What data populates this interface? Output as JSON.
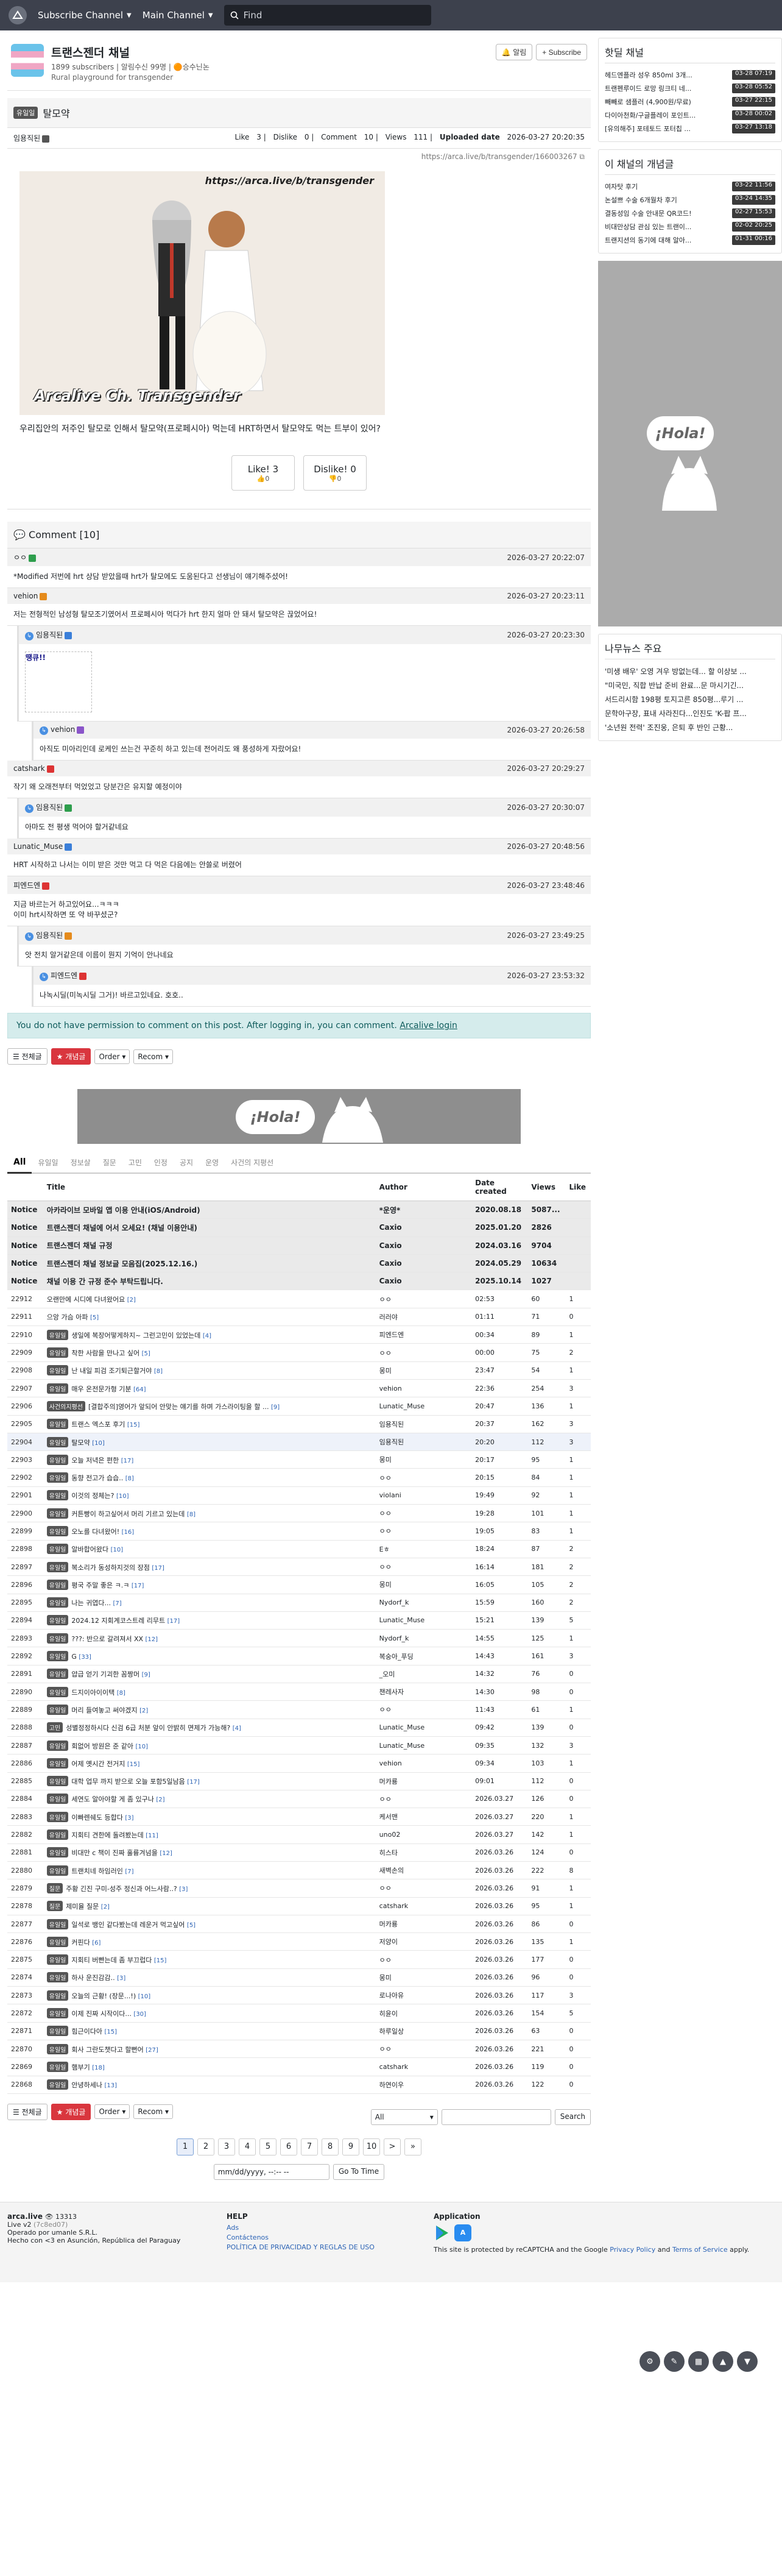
{
  "topbar": {
    "subscribe": "Subscribe Channel",
    "main": "Main Channel",
    "search_placeholder": "Find"
  },
  "channel": {
    "title": "트랜스젠더 채널",
    "meta": "1899 subscribers | 알림수신 99명 | 🟠승수닌논",
    "desc": "Rural playground for transgender",
    "alarm": "알림",
    "subscribe": "+ Subscribe"
  },
  "article": {
    "category": "유일일",
    "title": "탈모약",
    "author": "임용직된",
    "stats": {
      "like_label": "Like",
      "like": "3",
      "dislike_label": "Dislike",
      "dislike": "0",
      "comment_label": "Comment",
      "comment": "10",
      "views_label": "Views",
      "views": "111",
      "uploaded_label": "Uploaded date",
      "uploaded": "2026-03-27 20:20:35"
    },
    "url": "https://arca.live/b/transgender/166003267",
    "img_watermark": "https://arca.live/b/transgender",
    "img_caption": "Arcalive Ch. Transgender",
    "body": "우리집안의 저주인 탈모로 인해서 탈모약(프로페시아) 먹는데 HRT하면서 탈모약도 먹는 트부이 있어?",
    "vote": {
      "like": "Like!",
      "like_n": "3",
      "like_sub": "0",
      "dislike": "Dislike!",
      "dislike_n": "0",
      "dislike_sub": "0"
    }
  },
  "comments": {
    "header": "Comment [10]",
    "items": [
      {
        "author": "ㅇㅇ",
        "date": "2026-03-27 20:22:07",
        "text": "*Modified 저번에 hrt 상담 받았을때 hrt가 탈모에도 도움된다고 선생님이 얘기해주셨어!",
        "depth": 0
      },
      {
        "author": "vehion",
        "date": "2026-03-27 20:23:11",
        "text": "저는 전형적인 남성형 탈모조기였어서 프로페시아 먹다가 hrt 한지 얼마 안 돼서 탈모약은 끊었어요!",
        "depth": 0
      },
      {
        "author": "임용직된",
        "date": "2026-03-27 20:23:30",
        "text": "",
        "sticker": "땡큐!!",
        "depth": 1
      },
      {
        "author": "vehion",
        "date": "2026-03-27 20:26:58",
        "text": "아직도 미아리인데 로케인 쓰는건 꾸준히 하고 있는데 전어리도 왜 풍성하게 자랐어요!",
        "depth": 2
      },
      {
        "author": "catshark",
        "date": "2026-03-27 20:29:27",
        "text": "작기 왜 오래전부터 먹었었고 당분간은 유지할 예정이야",
        "depth": 0
      },
      {
        "author": "임용직된",
        "date": "2026-03-27 20:30:07",
        "text": "아마도 전 평생 먹어야 할거같네요",
        "depth": 1
      },
      {
        "author": "Lunatic_Muse",
        "date": "2026-03-27 20:48:56",
        "text": "HRT 시작하고 나서는 이미 받은 것만 먹고 다 먹은 다음에는 안쓸로 버렸어",
        "depth": 0
      },
      {
        "author": "피엔드엔",
        "date": "2026-03-27 23:48:46",
        "text": "지금 바르는거 하고있어요...ㅋㅋㅋ\n이미 hrt시작하면 또 약 바꾸셨군?",
        "depth": 0
      },
      {
        "author": "임용직된",
        "date": "2026-03-27 23:49:25",
        "text": "앗 전치 알거같은데 이름이 뭔지 기억이 안나네요",
        "depth": 1
      },
      {
        "author": "피엔드엔",
        "date": "2026-03-27 23:53:32",
        "text": "나녹시딜(미녹시딜 그거)! 바르고있네요. 호호..",
        "depth": 2
      }
    ],
    "no_permission": "You do not have permission to comment on this post. After logging in, you can comment.",
    "login": "Arcalive login"
  },
  "board": {
    "btn_all": "전체글",
    "btn_best": "개념글",
    "order": "Order",
    "recom": "Recom",
    "tabs": [
      "All",
      "유일일",
      "정보살",
      "질문",
      "고민",
      "인정",
      "공지",
      "운영",
      "사건의 지평선"
    ],
    "headers": {
      "no": "",
      "title": "Title",
      "author": "Author",
      "date": "Date created",
      "views": "Views",
      "like": "Like"
    },
    "notices": [
      {
        "no": "Notice",
        "title": "아카라이브 모바일 앱 이용 안내(iOS/Android)",
        "author": "*운영*",
        "date": "2020.08.18",
        "views": "5087...",
        "like": ""
      },
      {
        "no": "Notice",
        "title": "트랜스젠더 채널에 어서 오세요! (채널 이용안내)",
        "author": "Caxio",
        "date": "2025.01.20",
        "views": "2826",
        "like": ""
      },
      {
        "no": "Notice",
        "title": "트랜스젠더 채널 규정",
        "author": "Caxio",
        "date": "2024.03.16",
        "views": "9704",
        "like": ""
      },
      {
        "no": "Notice",
        "title": "트랜스젠더 채널 정보글 모음집(2025.12.16.)",
        "author": "Caxio",
        "date": "2024.05.29",
        "views": "10634",
        "like": ""
      },
      {
        "no": "Notice",
        "title": "채널 이용 간 규정 준수 부탁드립니다.",
        "author": "Caxio",
        "date": "2025.10.14",
        "views": "1027",
        "like": ""
      }
    ],
    "rows": [
      {
        "no": "22912",
        "cat": "",
        "title": "오랜만에 시디에 다녀왔어요",
        "cc": "[2]",
        "author": "ㅇㅇ",
        "date": "02:53",
        "views": "60",
        "like": "1"
      },
      {
        "no": "22911",
        "cat": "",
        "title": "으앙 가슴 아파",
        "cc": "[5]",
        "author": "러러야",
        "date": "01:11",
        "views": "71",
        "like": "0"
      },
      {
        "no": "22910",
        "cat": "유일일",
        "title": "생일에 복장어떻게하지~ 그런고민이 있었는데",
        "cc": "[4]",
        "author": "피엔드엔",
        "date": "00:34",
        "views": "89",
        "like": "1"
      },
      {
        "no": "22909",
        "cat": "유일일",
        "title": "착한 사람을 만나고 싶어",
        "cc": "[5]",
        "author": "ㅇㅇ",
        "date": "00:00",
        "views": "75",
        "like": "2"
      },
      {
        "no": "22908",
        "cat": "유일일",
        "title": "난 내일 피검 조기퇴근할거야",
        "cc": "[8]",
        "author": "몽미",
        "date": "23:47",
        "views": "54",
        "like": "1"
      },
      {
        "no": "22907",
        "cat": "유일일",
        "title": "매우 온전문가형 기분",
        "cc": "[64]",
        "author": "vehion",
        "date": "22:36",
        "views": "254",
        "like": "3"
      },
      {
        "no": "22906",
        "cat": "사건의지평선",
        "title": "[결합주의]영어가 앞되어 안맞는 얘기를 하며 가스라이팅을 할 ...",
        "cc": "[9]",
        "author": "Lunatic_Muse",
        "date": "20:47",
        "views": "136",
        "like": "1"
      },
      {
        "no": "22905",
        "cat": "유일일",
        "title": "트랜스 엑스포 후기",
        "cc": "[15]",
        "author": "임용직된",
        "date": "20:37",
        "views": "162",
        "like": "3"
      },
      {
        "no": "22904",
        "cat": "유일일",
        "title": "탈모약",
        "cc": "[10]",
        "author": "임용직된",
        "date": "20:20",
        "views": "112",
        "like": "3"
      },
      {
        "no": "22903",
        "cat": "유일일",
        "title": "오늘 저녁은 편한",
        "cc": "[17]",
        "author": "몽미",
        "date": "20:17",
        "views": "95",
        "like": "1"
      },
      {
        "no": "22902",
        "cat": "유일일",
        "title": "동향 전고가 습습..",
        "cc": "[8]",
        "author": "ㅇㅇ",
        "date": "20:15",
        "views": "84",
        "like": "1"
      },
      {
        "no": "22901",
        "cat": "유일일",
        "title": "이것의 정체는?",
        "cc": "[10]",
        "author": "violani",
        "date": "19:49",
        "views": "92",
        "like": "1"
      },
      {
        "no": "22900",
        "cat": "유일일",
        "title": "커튼빵이 하고싶어서 머리 기르고 있는데",
        "cc": "[8]",
        "author": "ㅇㅇ",
        "date": "19:28",
        "views": "101",
        "like": "1"
      },
      {
        "no": "22899",
        "cat": "유일일",
        "title": "오노를 다녀왔어!",
        "cc": "[16]",
        "author": "ㅇㅇ",
        "date": "19:05",
        "views": "83",
        "like": "1"
      },
      {
        "no": "22898",
        "cat": "유일일",
        "title": "알바합어왔다",
        "cc": "[10]",
        "author": "Eㅎ",
        "date": "18:24",
        "views": "87",
        "like": "2"
      },
      {
        "no": "22897",
        "cat": "유일일",
        "title": "복소리가 동성하지것의 장점",
        "cc": "[17]",
        "author": "ㅇㅇ",
        "date": "16:14",
        "views": "181",
        "like": "2"
      },
      {
        "no": "22896",
        "cat": "유일일",
        "title": "평국 주말 좋은 ㅋ.ㅋ",
        "cc": "[17]",
        "author": "몽미",
        "date": "16:05",
        "views": "105",
        "like": "2"
      },
      {
        "no": "22895",
        "cat": "유일일",
        "title": "나는 귀엽다...",
        "cc": "[7]",
        "author": "Nydorf_k",
        "date": "15:59",
        "views": "160",
        "like": "2"
      },
      {
        "no": "22894",
        "cat": "유일일",
        "title": "2024.12 지회계코스트레 리무트",
        "cc": "[17]",
        "author": "Lunatic_Muse",
        "date": "15:21",
        "views": "139",
        "like": "5"
      },
      {
        "no": "22893",
        "cat": "유일일",
        "title": "???: 반으로 갈려져서 XX",
        "cc": "[12]",
        "author": "Nydorf_k",
        "date": "14:55",
        "views": "125",
        "like": "1"
      },
      {
        "no": "22892",
        "cat": "유일일",
        "title": "G",
        "cc": "[33]",
        "author": "복숭아_푸딩",
        "date": "14:43",
        "views": "161",
        "like": "3"
      },
      {
        "no": "22891",
        "cat": "유일일",
        "title": "얍급 얻기 기괴한 꼼짱머",
        "cc": "[9]",
        "author": "_오미",
        "date": "14:32",
        "views": "76",
        "like": "0"
      },
      {
        "no": "22890",
        "cat": "유일일",
        "title": "드지이아이이택",
        "cc": "[8]",
        "author": "챈레사자",
        "date": "14:30",
        "views": "98",
        "like": "0"
      },
      {
        "no": "22889",
        "cat": "유일일",
        "title": "머리 들여놓고 써야겠지",
        "cc": "[2]",
        "author": "ㅇㅇ",
        "date": "11:43",
        "views": "61",
        "like": "1"
      },
      {
        "no": "22888",
        "cat": "고민",
        "title": "성별정정하시다 신검 6급 처분 앞이 안밝히 면제가 가능해?",
        "cc": "[4]",
        "author": "Lunatic_Muse",
        "date": "09:42",
        "views": "139",
        "like": "0"
      },
      {
        "no": "22887",
        "cat": "유일일",
        "title": "회없어 방원은 준 같아",
        "cc": "[10]",
        "author": "Lunatic_Muse",
        "date": "09:35",
        "views": "132",
        "like": "3"
      },
      {
        "no": "22886",
        "cat": "유일일",
        "title": "어제 옛시간 전거지",
        "cc": "[15]",
        "author": "vehion",
        "date": "09:34",
        "views": "103",
        "like": "1"
      },
      {
        "no": "22885",
        "cat": "유일일",
        "title": "대학 업무 까지 받으로 오늘 포함5일남음",
        "cc": "[17]",
        "author": "머카룡",
        "date": "09:01",
        "views": "112",
        "like": "0"
      },
      {
        "no": "22884",
        "cat": "유일일",
        "title": "세연도 알아야할 게 좀 있구나",
        "cc": "[2]",
        "author": "ㅇㅇ",
        "date": "2026.03.27",
        "views": "126",
        "like": "0"
      },
      {
        "no": "22883",
        "cat": "유일일",
        "title": "이빠렌쉐도 등합다",
        "cc": "[3]",
        "author": "케서맨",
        "date": "2026.03.27",
        "views": "220",
        "like": "1"
      },
      {
        "no": "22882",
        "cat": "유일일",
        "title": "지회티 견한에 돌려봤는데",
        "cc": "[11]",
        "author": "uno02",
        "date": "2026.03.27",
        "views": "142",
        "like": "1"
      },
      {
        "no": "22881",
        "cat": "유일일",
        "title": "비대만 c 책이 진짜 훌륭겨넘을",
        "cc": "[12]",
        "author": "히스타",
        "date": "2026.03.26",
        "views": "124",
        "like": "0"
      },
      {
        "no": "22880",
        "cat": "유일일",
        "title": "트랜치네 하임러인",
        "cc": "[7]",
        "author": "새벽손의",
        "date": "2026.03.26",
        "views": "222",
        "like": "8"
      },
      {
        "no": "22879",
        "cat": "질문",
        "title": "주황 긴진 구미-성주 정신과 어느사람..?",
        "cc": "[3]",
        "author": "ㅇㅇ",
        "date": "2026.03.26",
        "views": "91",
        "like": "1"
      },
      {
        "no": "22878",
        "cat": "질문",
        "title": "제미율 질문",
        "cc": "[2]",
        "author": "catshark",
        "date": "2026.03.26",
        "views": "95",
        "like": "1"
      },
      {
        "no": "22877",
        "cat": "유일일",
        "title": "일석로 뱅인 같다봤는데 레운거 먹고싶어",
        "cc": "[5]",
        "author": "머카룡",
        "date": "2026.03.26",
        "views": "86",
        "like": "0"
      },
      {
        "no": "22876",
        "cat": "유일일",
        "title": "커핀다",
        "cc": "[6]",
        "author": "저양이",
        "date": "2026.03.26",
        "views": "135",
        "like": "1"
      },
      {
        "no": "22875",
        "cat": "유일일",
        "title": "지회티 버빤는데 좀 부끄럽다",
        "cc": "[15]",
        "author": "ㅇㅇ",
        "date": "2026.03.26",
        "views": "177",
        "like": "0"
      },
      {
        "no": "22874",
        "cat": "유일일",
        "title": "하사 운진감감..",
        "cc": "[3]",
        "author": "몽미",
        "date": "2026.03.26",
        "views": "96",
        "like": "0"
      },
      {
        "no": "22873",
        "cat": "유일일",
        "title": "오늘의 근황! (장문...!)",
        "cc": "[10]",
        "author": "로나아유",
        "date": "2026.03.26",
        "views": "117",
        "like": "3"
      },
      {
        "no": "22872",
        "cat": "유일일",
        "title": "이제 진짜 시작이다...",
        "cc": "[30]",
        "author": "히윤이",
        "date": "2026.03.26",
        "views": "154",
        "like": "5"
      },
      {
        "no": "22871",
        "cat": "유일일",
        "title": "힘근이다아",
        "cc": "[15]",
        "author": "하루일상",
        "date": "2026.03.26",
        "views": "63",
        "like": "0"
      },
      {
        "no": "22870",
        "cat": "유일일",
        "title": "회사 그란도챗다고 할뻔어",
        "cc": "[27]",
        "author": "ㅇㅇ",
        "date": "2026.03.26",
        "views": "221",
        "like": "0"
      },
      {
        "no": "22869",
        "cat": "유일일",
        "title": "햄부기",
        "cc": "[18]",
        "author": "catshark",
        "date": "2026.03.26",
        "views": "119",
        "like": "0"
      },
      {
        "no": "22868",
        "cat": "유일일",
        "title": "안녕하세나",
        "cc": "[13]",
        "author": "하연이우",
        "date": "2026.03.26",
        "views": "122",
        "like": "0"
      }
    ],
    "search": {
      "scope": "All",
      "button": "Search"
    },
    "pages": [
      "1",
      "2",
      "3",
      "4",
      "5",
      "6",
      "7",
      "8",
      "9",
      "10",
      ">",
      "»"
    ],
    "date_placeholder": "mm/dd/yyyy,  --:-- --",
    "goto": "Go To Time"
  },
  "sidebar": {
    "hot_title": "핫딜 채널",
    "hot": [
      {
        "t": "헤드엔플라 성우 850ml 3개...",
        "tm": "03-28 07:19"
      },
      {
        "t": "트랜펜루이드 로망 링크티 네...",
        "tm": "03-28 05:52"
      },
      {
        "t": "빼빼로 샘플러 (4,900원/무료)",
        "tm": "03-27 22:15"
      },
      {
        "t": "다이아천화/구글플레이 포인트...",
        "tm": "03-28 00:02"
      },
      {
        "t": "[유의해주] 포테토드 포터칩 ...",
        "tm": "03-27 13:18"
      }
    ],
    "best_title": "이 채널의 개념글",
    "best": [
      {
        "t": "여자탓 후기",
        "tm": "03-22 11:56"
      },
      {
        "t": "논설쁘 수술 6개월차 후기",
        "tm": "03-24 14:35"
      },
      {
        "t": "결동성임 수술 안내문 QR코드!",
        "tm": "02-27 15:53"
      },
      {
        "t": "비대만상담 관심 있는 트랜이...",
        "tm": "02-02 20:25"
      },
      {
        "t": "트랜지션의 동기에 대해 알아...",
        "tm": "01-31 00:16"
      }
    ],
    "news_title": "나무뉴스 주요",
    "news": [
      "'미생 배우' 오영 겨우 방없는데... 할 이상보 ...",
      "\"미국민, 직합 반납 준비 완료...문 마시기긴...",
      "서드리시함 198평 토지고른 850평...루기 ...",
      "문학아구장, 표내 사라진다...인진도 'K-팝 프...",
      "'소년원 전력' 조진웅, 은퇴 후 반인 근황..."
    ]
  },
  "footer": {
    "brand": "arca.live",
    "counter": "13313",
    "ver": "Live v2",
    "commit": "(7c8ed07)",
    "op": "Operado por umanle S.R.L.",
    "made": "Hecho con <3 en Asunción, República del Paraguay",
    "help": "HELP",
    "links": [
      "Ads",
      "Contáctenos",
      "POLÍTICA DE PRIVACIDAD Y REGLAS DE USO"
    ],
    "app": "Application",
    "recaptcha": "This site is protected by reCAPTCHA and the Google",
    "privacy": "Privacy Policy",
    "and": "and",
    "terms": "Terms of Service",
    "apply": "apply."
  },
  "colors": {
    "topbar": "#3d414d",
    "notice_bg": "#d5ecec",
    "best_btn": "#d9363e"
  }
}
